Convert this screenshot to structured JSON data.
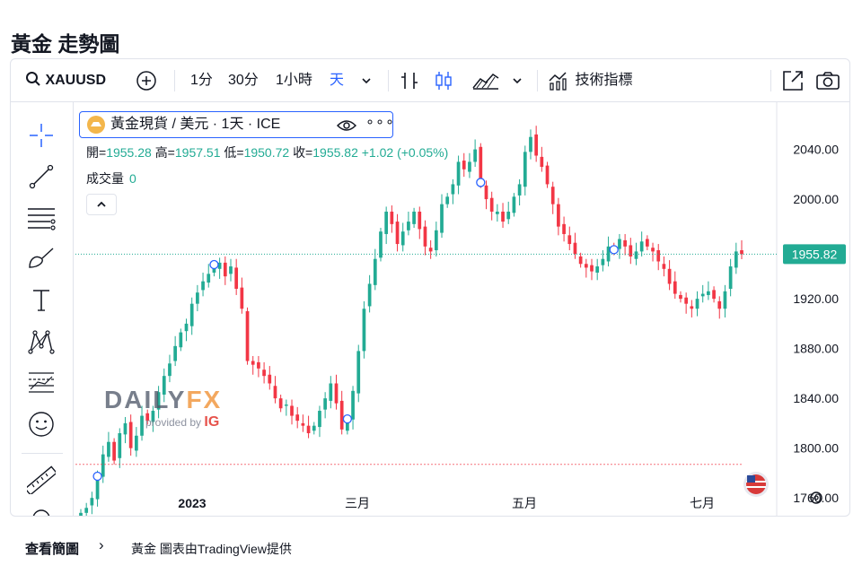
{
  "page_title": "黃金 走勢圖",
  "toolbar": {
    "symbol": "XAUUSD",
    "intervals": [
      "1分",
      "30分",
      "1小時",
      "天"
    ],
    "indicators_label": "技術指標"
  },
  "legend": {
    "title": "黃金現貨 / 美元 · 1天 · ICE",
    "dots": "∘∘∘",
    "open_label": "開=",
    "open": "1955.28",
    "high_label": "高=",
    "high": "1957.51",
    "low_label": "低=",
    "low": "1950.72",
    "close_label": "收=",
    "close": "1955.82",
    "change": "+1.02",
    "change_pct": "(+0.05%)",
    "volume_label": "成交量",
    "volume": "0"
  },
  "watermark": {
    "brand_a": "DAILY",
    "brand_b": "FX",
    "provided_by": "provided by",
    "ig": "IG"
  },
  "footer": {
    "link": "查看簡圖",
    "chevron": "›",
    "note": "黃金 圖表由TradingView提供"
  },
  "colors": {
    "up": "#22ab94",
    "down": "#f23645",
    "accent": "#2962ff",
    "last_price_bg": "#22ab94"
  },
  "chart_data": {
    "type": "candlestick",
    "title": "黃金現貨 / 美元 · 1天 · ICE",
    "y_ticks": [
      "1760.00",
      "1800.00",
      "1840.00",
      "1880.00",
      "1920.00",
      "1960.00",
      "2000.00",
      "2040.00"
    ],
    "y_range": [
      1745,
      2075
    ],
    "x_ticks": [
      "2023",
      "三月",
      "五月",
      "七月"
    ],
    "last_price": "1955.82",
    "last_price_value": 1955.82,
    "reference_level": 1787,
    "closes": [
      1748,
      1752,
      1760,
      1776,
      1795,
      1805,
      1790,
      1812,
      1820,
      1800,
      1810,
      1826,
      1822,
      1830,
      1845,
      1858,
      1868,
      1882,
      1893,
      1900,
      1916,
      1925,
      1934,
      1940,
      1946,
      1949,
      1938,
      1946,
      1928,
      1912,
      1870,
      1867,
      1864,
      1858,
      1852,
      1840,
      1832,
      1835,
      1826,
      1822,
      1818,
      1812,
      1818,
      1830,
      1840,
      1852,
      1836,
      1815,
      1822,
      1846,
      1878,
      1912,
      1932,
      1952,
      1974,
      1990,
      1980,
      1964,
      1974,
      1982,
      1990,
      1976,
      1962,
      1958,
      1975,
      1996,
      2002,
      2012,
      2030,
      2024,
      2030,
      2040,
      2012,
      2000,
      1990,
      1990,
      1982,
      1990,
      2002,
      2012,
      2038,
      2050,
      2035,
      2026,
      2012,
      1996,
      1978,
      1972,
      1964,
      1956,
      1948,
      1945,
      1942,
      1946,
      1952,
      1962,
      1958,
      1968,
      1962,
      1954,
      1958,
      1966,
      1962,
      1958,
      1950,
      1944,
      1932,
      1924,
      1920,
      1916,
      1912,
      1920,
      1924,
      1926,
      1920,
      1912,
      1926,
      1946,
      1958,
      1955.82
    ]
  }
}
